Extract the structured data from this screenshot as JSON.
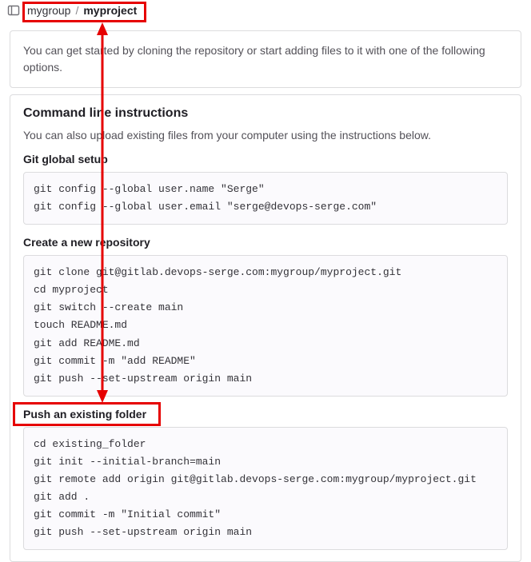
{
  "breadcrumb": {
    "group": "mygroup",
    "separator": "/",
    "project": "myproject"
  },
  "intro": "You can get started by cloning the repository or start adding files to it with one of the following options.",
  "cli": {
    "heading": "Command line instructions",
    "subtext": "You can also upload existing files from your computer using the instructions below.",
    "sections": {
      "global_setup": {
        "title": "Git global setup",
        "code": "git config --global user.name \"Serge\"\ngit config --global user.email \"serge@devops-serge.com\""
      },
      "create_repo": {
        "title": "Create a new repository",
        "code": "git clone git@gitlab.devops-serge.com:mygroup/myproject.git\ncd myproject\ngit switch --create main\ntouch README.md\ngit add README.md\ngit commit -m \"add README\"\ngit push --set-upstream origin main"
      },
      "push_existing": {
        "title": "Push an existing folder",
        "code": "cd existing_folder\ngit init --initial-branch=main\ngit remote add origin git@gitlab.devops-serge.com:mygroup/myproject.git\ngit add .\ngit commit -m \"Initial commit\"\ngit push --set-upstream origin main"
      }
    }
  }
}
